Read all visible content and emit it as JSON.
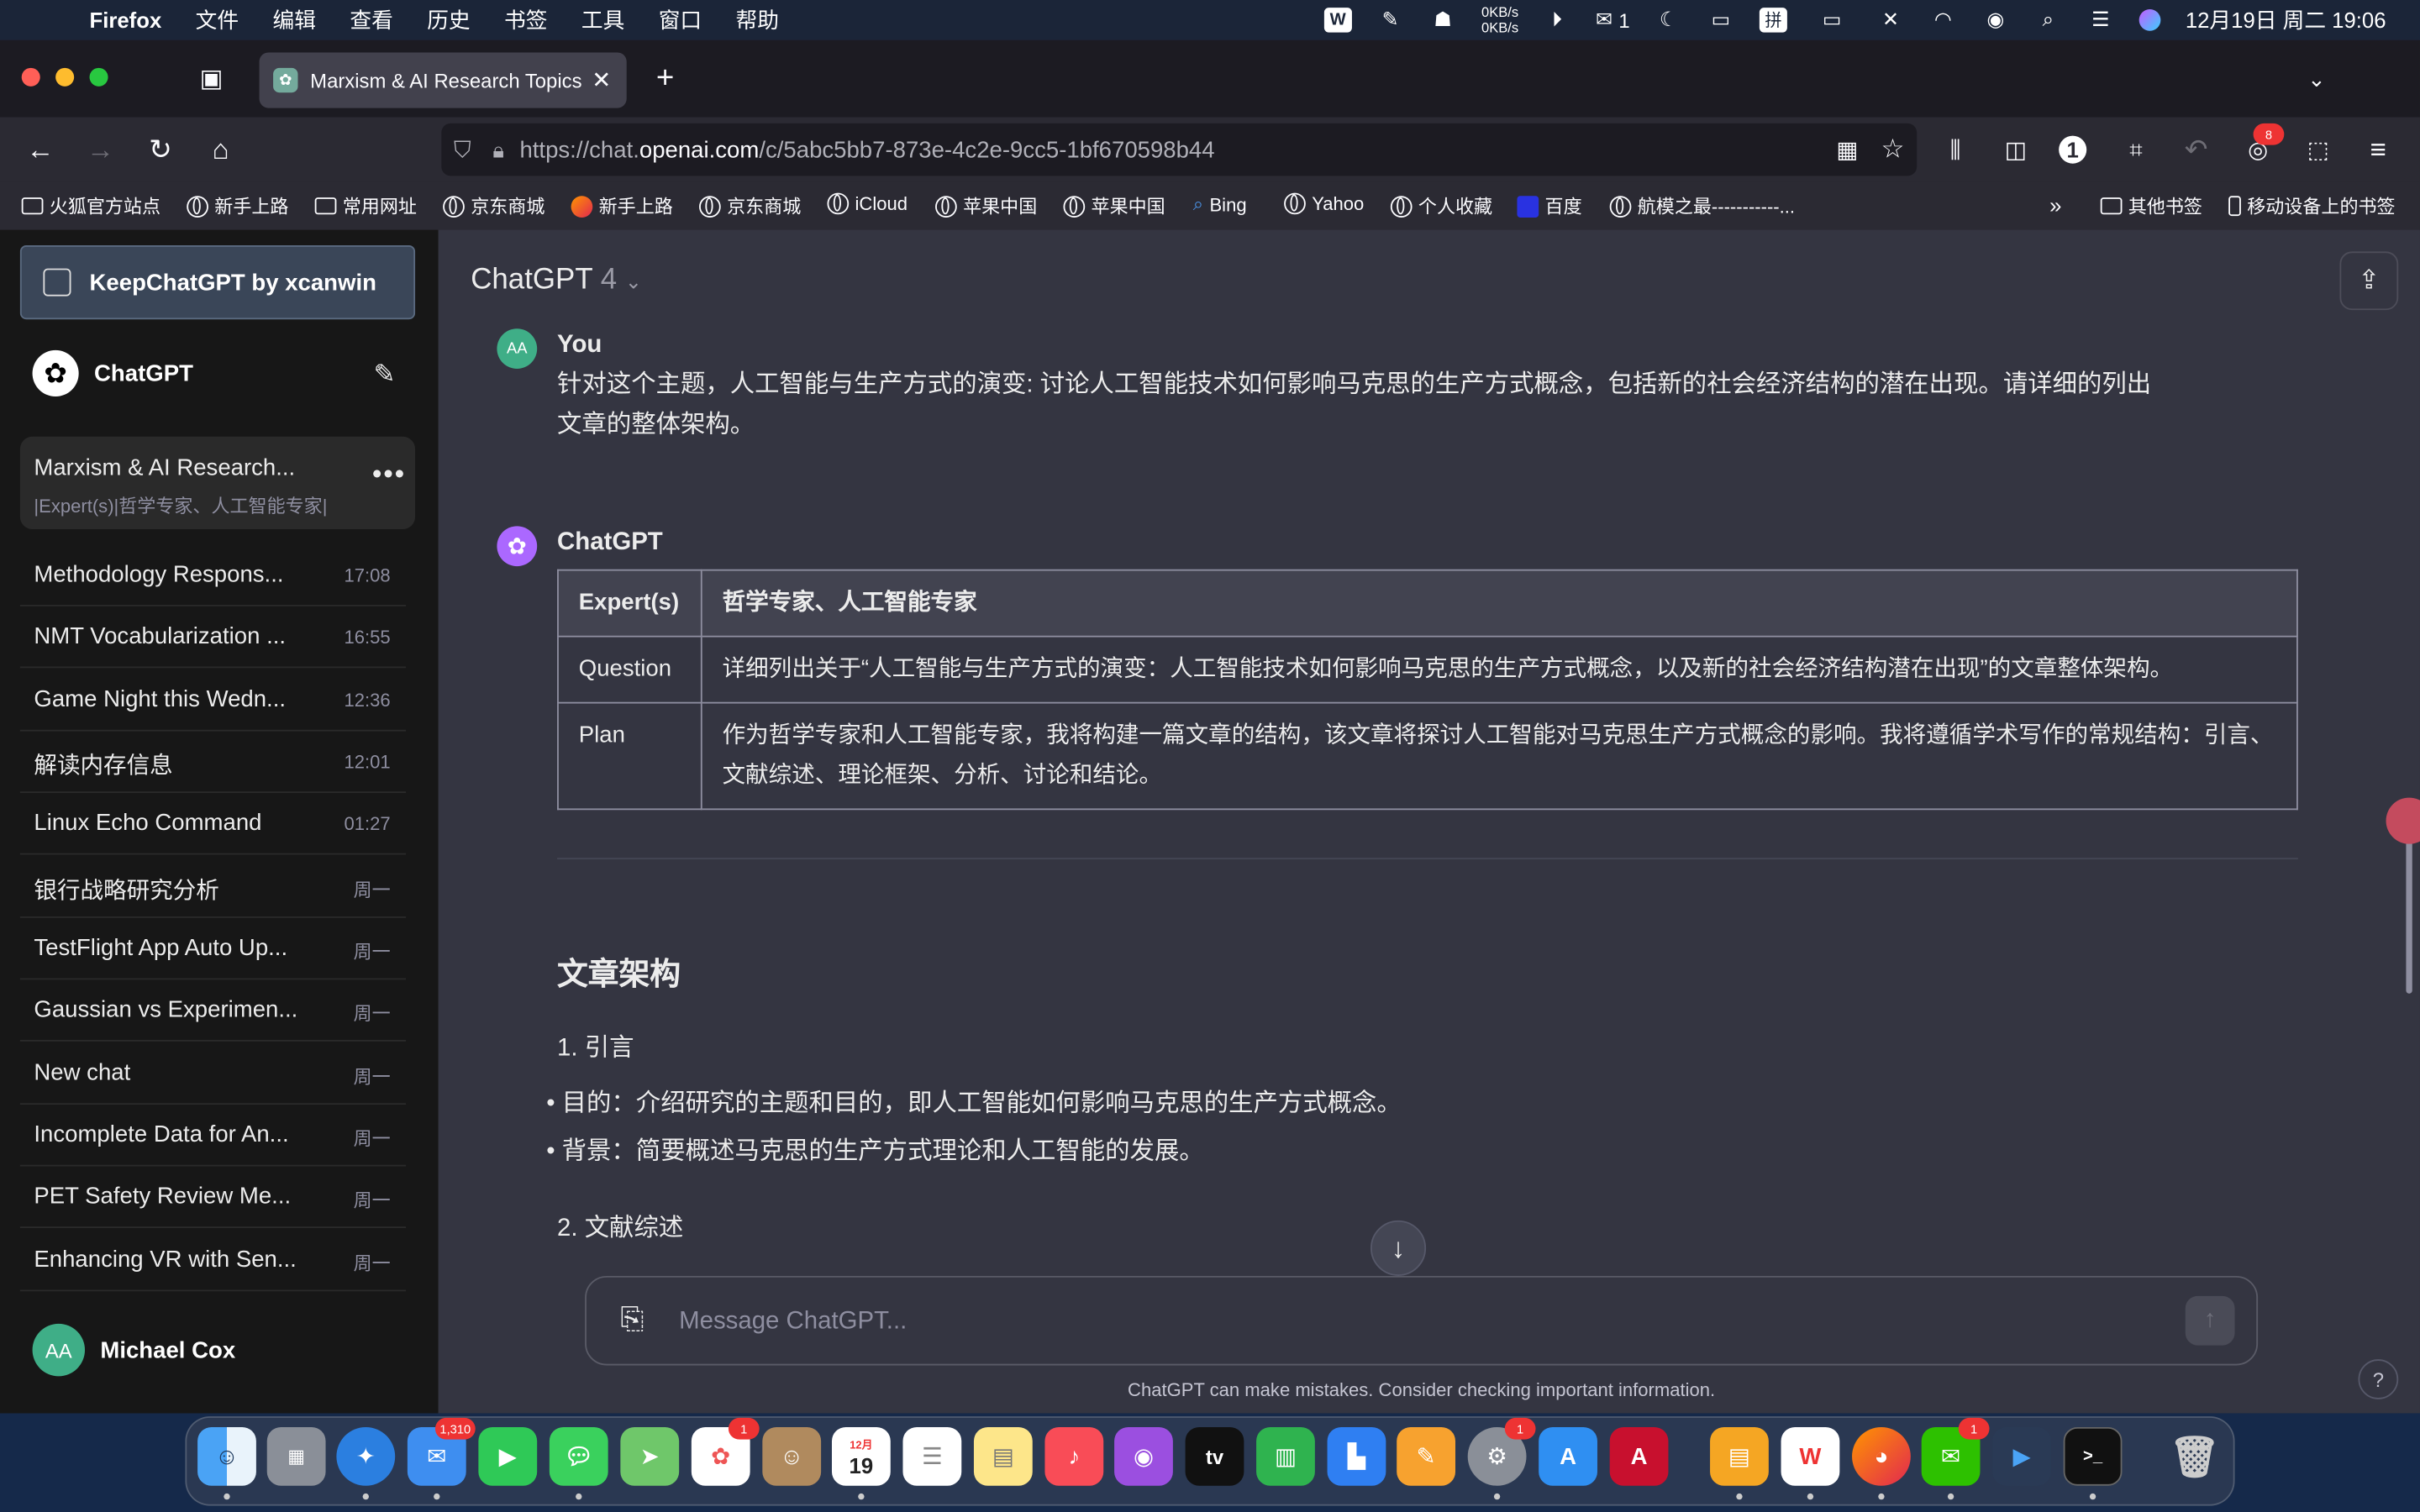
{
  "menubar": {
    "app": "Firefox",
    "items": [
      "文件",
      "编辑",
      "查看",
      "历史",
      "书签",
      "工具",
      "窗口",
      "帮助"
    ],
    "net_up": "0KB/s",
    "net_down": "0KB/s",
    "wechat_count": "1",
    "datetime": "12月19日 周二  19:06"
  },
  "browser": {
    "tab_title": "Marxism & AI Research Topics",
    "url_prefix": "https://chat.",
    "url_host": "openai.com",
    "url_path": "/c/5abc5bb7-873e-4c2e-9cc5-1bf670598b44",
    "extension_badge": "8",
    "bookmarks": [
      "火狐官方站点",
      "新手上路",
      "常用网址",
      "京东商城",
      "新手上路",
      "京东商城",
      "iCloud",
      "苹果中国",
      "苹果中国",
      "Bing",
      "Yahoo",
      "个人收藏",
      "百度",
      "航模之最-----------..."
    ],
    "bookmarks_other": "其他书签",
    "bookmarks_mobile": "移动设备上的书签"
  },
  "sidebar": {
    "extension_label": "KeepChatGPT by xcanwin",
    "brand": "ChatGPT",
    "active_chat": {
      "title": "Marxism & AI Research...",
      "snippet": "|Expert(s)|哲学专家、人工智能专家|"
    },
    "chats": [
      {
        "title": "Methodology Respons...",
        "time": "17:08"
      },
      {
        "title": "NMT Vocabularization ...",
        "time": "16:55"
      },
      {
        "title": "Game Night this Wedn...",
        "time": "12:36"
      },
      {
        "title": "解读内存信息",
        "time": "12:01"
      },
      {
        "title": "Linux Echo Command",
        "time": "01:27"
      },
      {
        "title": "银行战略研究分析",
        "time": "周一"
      },
      {
        "title": "TestFlight App Auto Up...",
        "time": "周一"
      },
      {
        "title": "Gaussian vs Experimen...",
        "time": "周一"
      },
      {
        "title": "New chat",
        "time": "周一"
      },
      {
        "title": "Incomplete Data for An...",
        "time": "周一"
      },
      {
        "title": "PET Safety Review Me...",
        "time": "周一"
      },
      {
        "title": "Enhancing VR with Sen...",
        "time": "周一"
      }
    ],
    "user": {
      "initials": "AA",
      "name": "Michael Cox"
    }
  },
  "main": {
    "model": "ChatGPT",
    "model_version": "4",
    "user_msg": {
      "initials": "AA",
      "name": "You",
      "line1": "针对这个主题，人工智能与生产方式的演变: 讨论人工智能技术如何影响马克思的生产方式概念，包括新的社会经济结构的潜在出现。请详细的列出",
      "line2": "文章的整体架构。"
    },
    "bot_msg": {
      "name": "ChatGPT",
      "table": {
        "h1": "Expert(s)",
        "h2": "哲学专家、人工智能专家",
        "r1_label": "Question",
        "r1_value": "详细列出关于“人工智能与生产方式的演变：人工智能技术如何影响马克思的生产方式概念，以及新的社会经济结构潜在出现”的文章整体架构。",
        "r2_label": "Plan",
        "r2_value": "作为哲学专家和人工智能专家，我将构建一篇文章的结构，该文章将探讨人工智能对马克思生产方式概念的影响。我将遵循学术写作的常规结构：引言、文献综述、理论框架、分析、讨论和结论。"
      },
      "heading": "文章架构",
      "section1": "1. 引言",
      "bullet1": "目的：介绍研究的主题和目的，即人工智能如何影响马克思的生产方式概念。",
      "bullet2": "背景：简要概述马克思的生产方式理论和人工智能的发展。",
      "section2": "2. 文献综述"
    },
    "composer_placeholder": "Message ChatGPT...",
    "disclaimer": "ChatGPT can make mistakes. Consider checking important information.",
    "help": "?"
  },
  "dock": {
    "mail_badge": "1,310",
    "photos_badge": "1",
    "calendar_month": "12月",
    "calendar_day": "19",
    "tv_label": "tv",
    "settings_badge": "1",
    "wechat_badge": "1"
  }
}
